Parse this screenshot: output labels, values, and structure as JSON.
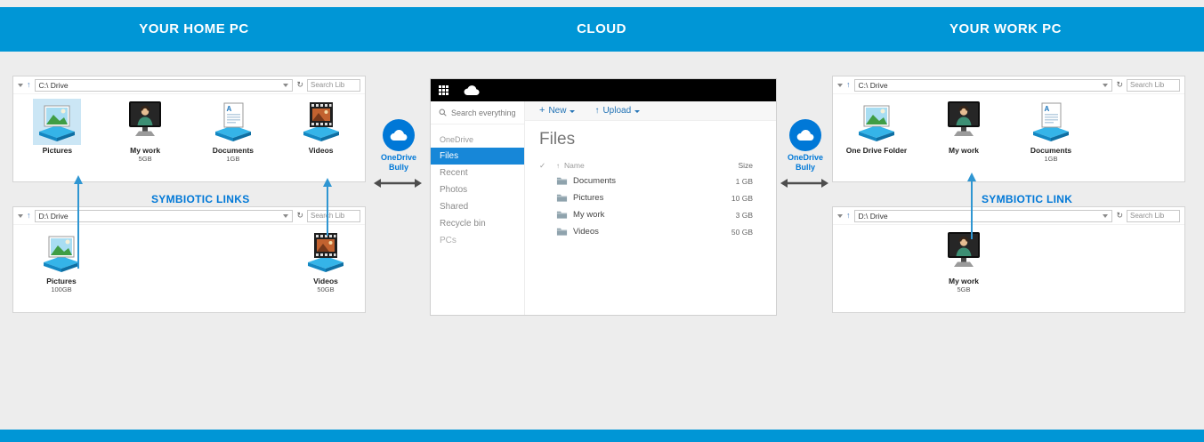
{
  "colors": {
    "banner_blue": "#0096d6",
    "accent_blue": "#0078d7",
    "nav_active_blue": "#1787d8",
    "selection_blue": "#cbe6f5",
    "link_arrow_blue": "#2f96d2"
  },
  "glyphs": {
    "up_arrow": "↑",
    "refresh": "↻",
    "plus": "+",
    "check": "✓",
    "sort_up": "↑"
  },
  "banner": {
    "home": "YOUR HOME PC",
    "cloud": "CLOUD",
    "work": "YOUR WORK PC"
  },
  "home_pc": {
    "drive_c": {
      "address": "C:\\ Drive",
      "search_placeholder": "Search Lib",
      "items": [
        {
          "label": "Pictures",
          "size": ""
        },
        {
          "label": "My work",
          "size": "5GB"
        },
        {
          "label": "Documents",
          "size": "1GB"
        },
        {
          "label": "Videos",
          "size": ""
        }
      ]
    },
    "link_label": "SYMBIOTIC LINKS",
    "drive_d": {
      "address": "D:\\ Drive",
      "search_placeholder": "Search Lib",
      "items": [
        {
          "label": "Pictures",
          "size": "100GB"
        },
        {
          "label": "Videos",
          "size": "50GB"
        }
      ]
    }
  },
  "work_pc": {
    "drive_c": {
      "address": "C:\\ Drive",
      "search_placeholder": "Search Lib",
      "items": [
        {
          "label": "One Drive Folder",
          "size": ""
        },
        {
          "label": "My work",
          "size": ""
        },
        {
          "label": "Documents",
          "size": "1GB"
        }
      ]
    },
    "link_label": "SYMBIOTIC LINK",
    "drive_d": {
      "address": "D:\\ Drive",
      "search_placeholder": "Search Lib",
      "items": [
        {
          "label": "My work",
          "size": "5GB"
        }
      ]
    }
  },
  "connectors": {
    "left_label": "OneDrive Bully",
    "right_label": "OneDrive Bully"
  },
  "onedrive": {
    "search_placeholder": "Search everything",
    "nav": [
      {
        "label": "OneDrive"
      },
      {
        "label": "Files"
      },
      {
        "label": "Recent"
      },
      {
        "label": "Photos"
      },
      {
        "label": "Shared"
      },
      {
        "label": "Recycle bin"
      },
      {
        "label": "PCs"
      }
    ],
    "active_nav": "Files",
    "toolbar": {
      "new": "New",
      "upload": "Upload"
    },
    "title": "Files",
    "table": {
      "name_header": "Name",
      "size_header": "Size",
      "rows": [
        {
          "name": "Documents",
          "size": "1 GB"
        },
        {
          "name": "Pictures",
          "size": "10 GB"
        },
        {
          "name": "My work",
          "size": "3 GB"
        },
        {
          "name": "Videos",
          "size": "50 GB"
        }
      ]
    }
  }
}
